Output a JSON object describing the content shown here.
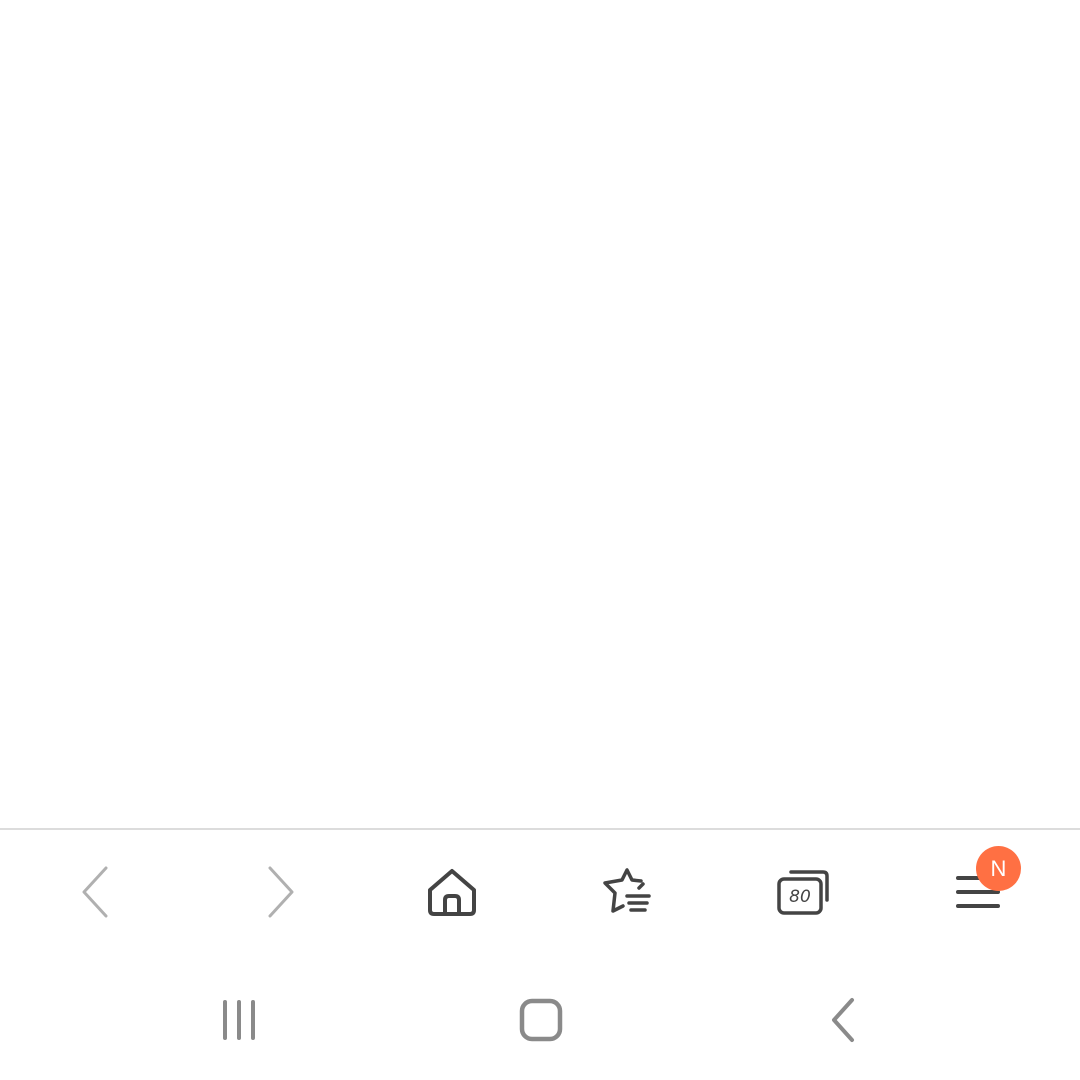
{
  "browser_toolbar": {
    "buttons": [
      {
        "name": "back",
        "icon": "chevron-left-icon",
        "enabled": false
      },
      {
        "name": "forward",
        "icon": "chevron-right-icon",
        "enabled": false
      },
      {
        "name": "home",
        "icon": "home-icon",
        "enabled": true
      },
      {
        "name": "bookmarks",
        "icon": "star-list-icon",
        "enabled": true
      },
      {
        "name": "tabs",
        "icon": "tabs-icon",
        "enabled": true
      },
      {
        "name": "menu",
        "icon": "hamburger-menu-icon",
        "enabled": true
      }
    ],
    "tabs_count": "80",
    "menu_badge": "N",
    "badge_color": "#ff7043",
    "icon_color": "#444444",
    "disabled_icon_color": "#b0b0b0"
  },
  "system_nav": {
    "buttons": [
      {
        "name": "recent-apps",
        "icon": "recent-apps-icon"
      },
      {
        "name": "home",
        "icon": "home-outline-icon"
      },
      {
        "name": "back",
        "icon": "back-icon"
      }
    ],
    "icon_color": "#8a8a8a"
  }
}
